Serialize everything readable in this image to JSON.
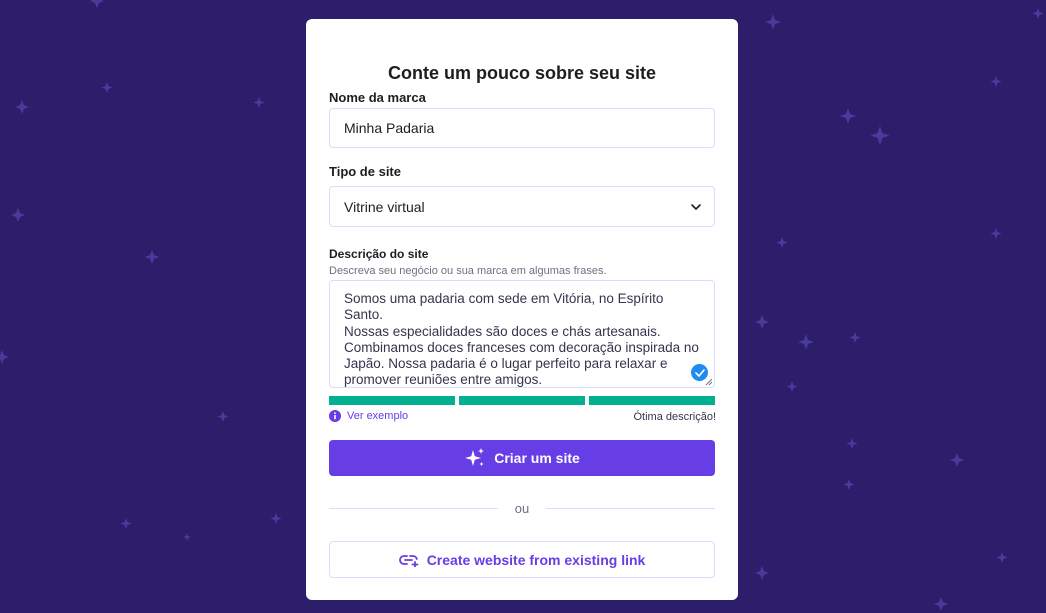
{
  "form": {
    "title": "Conte um pouco sobre seu site",
    "brand": {
      "label": "Nome da marca",
      "value": "Minha Padaria"
    },
    "site_type": {
      "label": "Tipo de site",
      "selected": "Vitrine virtual"
    },
    "description": {
      "label": "Descrição do site",
      "hint": "Descreva seu negócio ou sua marca em algumas frases.",
      "lines": [
        "Somos uma padaria com sede em Vitória, no Espírito Santo.",
        "Nossas especialidades são doces e chás artesanais.",
        "Combinamos doces franceses com decoração inspirada no",
        "Japão. Nossa padaria é o lugar perfeito para relaxar e",
        "promover reuniões entre amigos."
      ]
    },
    "strength": {
      "segments_filled": 3,
      "segments_total": 3,
      "label": "Ótima descrição!"
    },
    "example_link": "Ver exemplo",
    "create_button": "Criar um site",
    "divider_text": "ou",
    "link_button": "Create website from existing link"
  },
  "colors": {
    "background": "#2c1e6b",
    "accent": "#673de6",
    "success": "#00b090",
    "check": "#1f8cf0"
  },
  "icons": [
    "sparkles-icon",
    "chevron-down-icon",
    "check-circle-icon",
    "info-icon",
    "link-plus-icon"
  ]
}
